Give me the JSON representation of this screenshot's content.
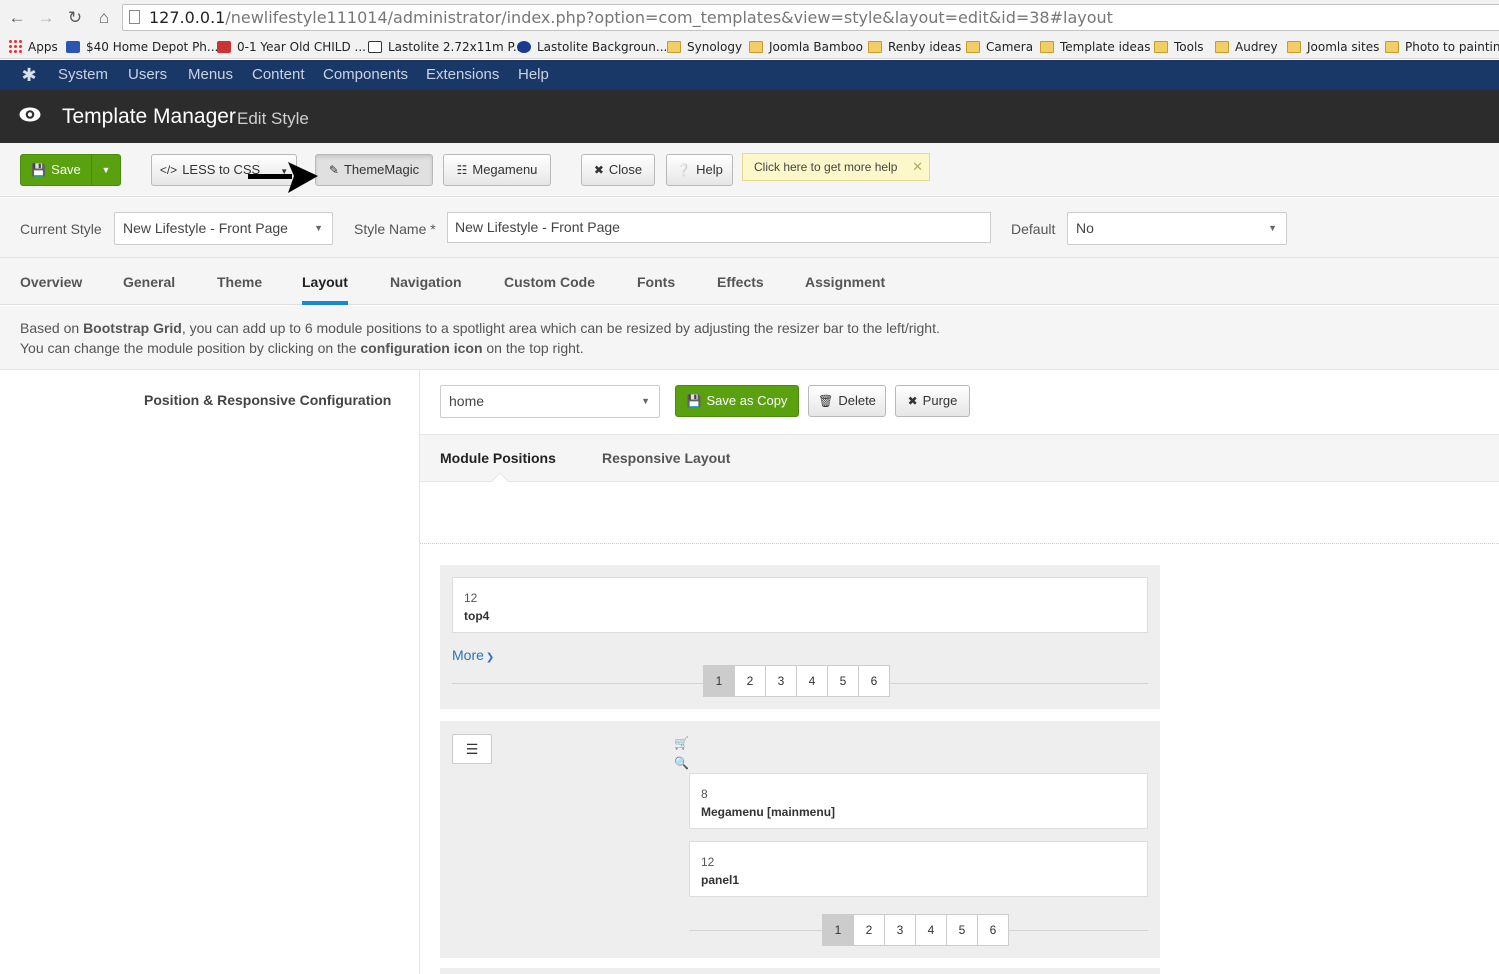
{
  "browser": {
    "url_host": "127.0.0.1",
    "url_path": "/newlifestyle111014/administrator/index.php?option=com_templates&view=style&layout=edit&id=38#layout",
    "bookmarks": [
      {
        "label": "Apps",
        "icon": "apps-grid-icon"
      },
      {
        "label": "$40 Home Depot Ph...",
        "icon": "site-favicon"
      },
      {
        "label": "0-1 Year Old CHILD ...",
        "icon": "site-favicon"
      },
      {
        "label": "Lastolite 2.72x11m P...",
        "icon": "site-favicon"
      },
      {
        "label": "Lastolite Backgroun...",
        "icon": "site-favicon"
      },
      {
        "label": "Synology",
        "icon": "folder-icon"
      },
      {
        "label": "Joomla Bamboo",
        "icon": "folder-icon"
      },
      {
        "label": "Renby ideas",
        "icon": "folder-icon"
      },
      {
        "label": "Camera",
        "icon": "folder-icon"
      },
      {
        "label": "Template ideas",
        "icon": "folder-icon"
      },
      {
        "label": "Tools",
        "icon": "folder-icon"
      },
      {
        "label": "Audrey",
        "icon": "folder-icon"
      },
      {
        "label": "Joomla sites",
        "icon": "folder-icon"
      },
      {
        "label": "Photo to painting",
        "icon": "folder-icon"
      }
    ]
  },
  "admin_menu": [
    "System",
    "Users",
    "Menus",
    "Content",
    "Components",
    "Extensions",
    "Help"
  ],
  "header": {
    "title": "Template Manager",
    "subtitle": "Edit Style"
  },
  "toolbar": {
    "save": "Save",
    "less_to_css": "LESS to CSS",
    "thememagic": "ThemeMagic",
    "megamenu": "Megamenu",
    "close": "Close",
    "help": "Help",
    "tip": "Click here to get more help"
  },
  "style_bar": {
    "current_style_label": "Current Style",
    "current_style_value": "New Lifestyle - Front Page",
    "style_name_label": "Style Name *",
    "style_name_value": "New Lifestyle - Front Page",
    "default_label": "Default",
    "default_value": "No"
  },
  "tabs": [
    "Overview",
    "General",
    "Theme",
    "Layout",
    "Navigation",
    "Custom Code",
    "Fonts",
    "Effects",
    "Assignment"
  ],
  "active_tab": "Layout",
  "info": {
    "l1a": "Based on ",
    "l1b": "Bootstrap Grid",
    "l1c": ", you can add up to 6 module positions to a spotlight area which can be resized by adjusting the resizer bar to the left/right.",
    "l2a": "You can change the module position by clicking on the ",
    "l2b": "configuration icon",
    "l2c": " on the top right."
  },
  "position_config": {
    "label": "Position & Responsive Configuration",
    "layout_select": "home",
    "save_as_copy": "Save as Copy",
    "delete": "Delete",
    "purge": "Purge"
  },
  "sub_tabs": [
    "Module Positions",
    "Responsive Layout"
  ],
  "blocks": {
    "top": {
      "width": "12",
      "name": "top4",
      "more": "More"
    },
    "menu": [
      {
        "width": "8",
        "name": "Megamenu [mainmenu]"
      },
      {
        "width": "12",
        "name": "panel1"
      }
    ]
  },
  "pager": [
    "1",
    "2",
    "3",
    "4",
    "5",
    "6"
  ],
  "colors": {
    "admin_nav": "#1a3867",
    "header": "#2c2c2c",
    "green": "#5aa110",
    "active_tab": "#1b87d2",
    "link": "#2d72b8"
  }
}
